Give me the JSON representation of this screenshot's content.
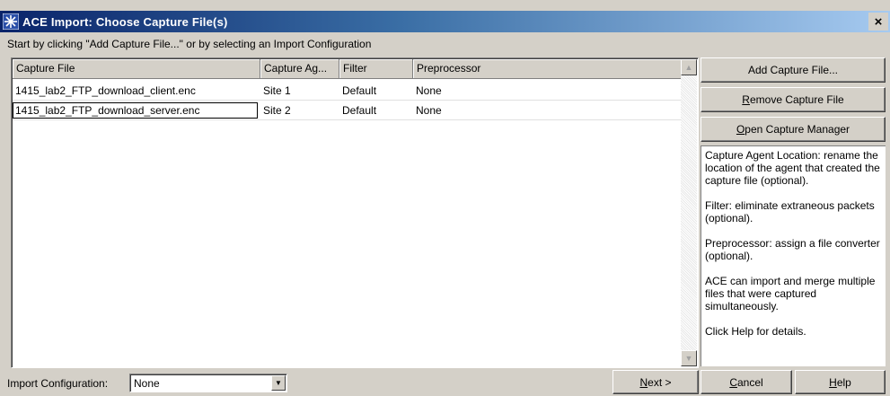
{
  "window": {
    "title": "ACE Import: Choose Capture File(s)",
    "close_glyph": "×"
  },
  "instruction": "Start by clicking \"Add Capture File...\" or by selecting an Import Configuration",
  "table": {
    "columns": [
      "Capture File",
      "Capture Ag...",
      "Filter",
      "Preprocessor"
    ],
    "rows": [
      {
        "file": "1415_lab2_FTP_download_client.enc",
        "agent": "Site 1",
        "filter": "Default",
        "preprocessor": "None"
      },
      {
        "file": "1415_lab2_FTP_download_server.enc",
        "agent": "Site 2",
        "filter": "Default",
        "preprocessor": "None"
      }
    ]
  },
  "buttons": {
    "add_capture": "Add Capture File...",
    "remove_capture_key": "R",
    "remove_capture_rest": "emove Capture File",
    "open_manager_key": "O",
    "open_manager_rest": "pen Capture Manager",
    "next_key": "N",
    "next_rest": "ext >",
    "cancel_key": "C",
    "cancel_rest": "ancel",
    "help_key": "H",
    "help_rest": "elp"
  },
  "help_text": [
    "Capture Agent Location: rename the location of the agent that created the capture file (optional).",
    "Filter: eliminate extraneous packets (optional).",
    "Preprocessor: assign a file converter (optional).",
    "ACE can import and merge multiple files that were captured simultaneously.",
    "Click Help for details."
  ],
  "import_config": {
    "label": "Import Configuration:",
    "value": "None"
  },
  "icons": {
    "title_icon": "ace-star-icon",
    "scroll_up": "scroll-up-arrow-icon",
    "scroll_down": "scroll-down-arrow-icon",
    "dropdown": "chevron-down-icon"
  },
  "colors": {
    "title_bar_start": "#0a246a",
    "title_bar_end": "#a6caf0",
    "dialog_bg": "#d4d0c8"
  }
}
